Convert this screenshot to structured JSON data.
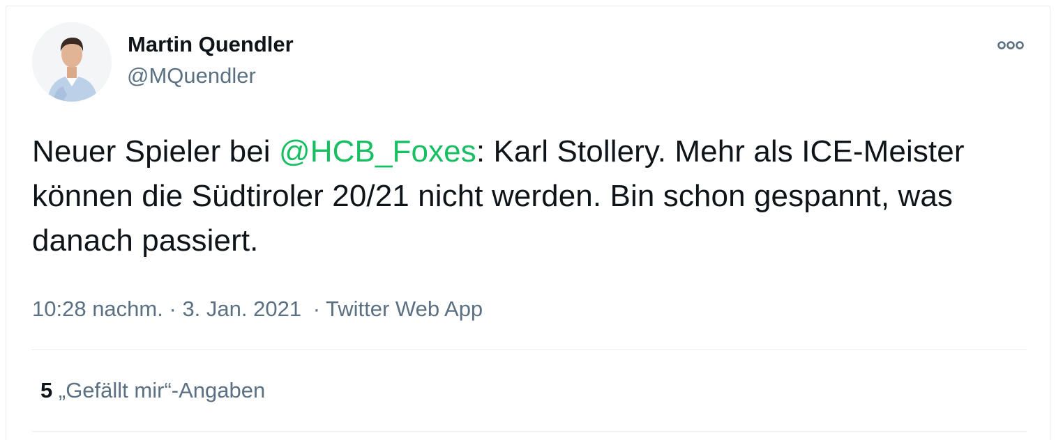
{
  "author": {
    "display_name": "Martin Quendler",
    "handle": "@MQuendler",
    "avatar_icon": "profile-photo"
  },
  "menu": {
    "icon": "more-options-icon"
  },
  "tweet": {
    "text_before_mention": "Neuer Spieler bei ",
    "mention": "@HCB_Foxes",
    "text_after_mention": ": Karl Stollery. Mehr als ICE-Meister können die Südtiroler 20/21 nicht werden. Bin schon gespannt, was danach passiert.",
    "mention_color": "#17bf63"
  },
  "meta": {
    "time": "10:28 nachm.",
    "separator": "·",
    "date": "3. Jan. 2021",
    "source": "Twitter Web App"
  },
  "stats": {
    "likes_count": "5",
    "likes_label": "„Gefällt mir“-Angaben"
  },
  "colors": {
    "text": "#0f1419",
    "secondary": "#5b7083",
    "border": "#e6ecf0"
  }
}
